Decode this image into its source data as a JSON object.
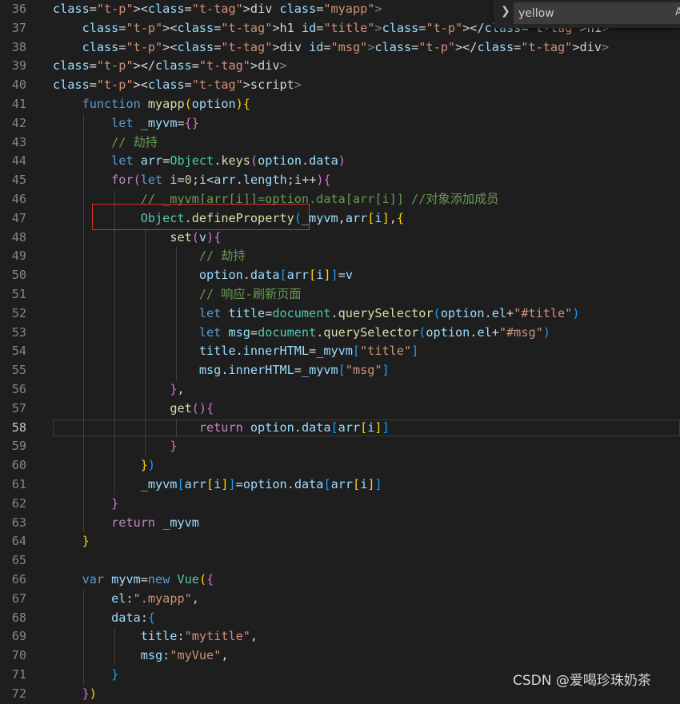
{
  "find_widget": {
    "query": "yellow",
    "toggle_label": "A"
  },
  "watermark": "CSDN @爱喝珍珠奶茶",
  "active_line": "58",
  "highlight_box_target": "Object.defineProperty(",
  "lines": [
    {
      "no": "36",
      "text": "<div class=\"myapp\">"
    },
    {
      "no": "37",
      "text": "    <h1 id=\"title\"></h1>"
    },
    {
      "no": "38",
      "text": "    <div id=\"msg\"></div>"
    },
    {
      "no": "39",
      "text": "</div>"
    },
    {
      "no": "40",
      "text": "<script>"
    },
    {
      "no": "41",
      "text": "    function myapp(option){"
    },
    {
      "no": "42",
      "text": "        let _myvm={}"
    },
    {
      "no": "43",
      "text": "        // 劫持"
    },
    {
      "no": "44",
      "text": "        let arr=Object.keys(option.data)"
    },
    {
      "no": "45",
      "text": "        for(let i=0;i<arr.length;i++){"
    },
    {
      "no": "46",
      "text": "            // _myvm[arr[i]]=option.data[arr[i]] //对象添加成员"
    },
    {
      "no": "47",
      "text": "            Object.defineProperty(_myvm,arr[i],{"
    },
    {
      "no": "48",
      "text": "                set(v){"
    },
    {
      "no": "49",
      "text": "                    // 劫持"
    },
    {
      "no": "50",
      "text": "                    option.data[arr[i]]=v"
    },
    {
      "no": "51",
      "text": "                    // 响应-刷新页面"
    },
    {
      "no": "52",
      "text": "                    let title=document.querySelector(option.el+\"#title\")"
    },
    {
      "no": "53",
      "text": "                    let msg=document.querySelector(option.el+\"#msg\")"
    },
    {
      "no": "54",
      "text": "                    title.innerHTML=_myvm[\"title\"]"
    },
    {
      "no": "55",
      "text": "                    msg.innerHTML=_myvm[\"msg\"]"
    },
    {
      "no": "56",
      "text": "                },"
    },
    {
      "no": "57",
      "text": "                get(){"
    },
    {
      "no": "58",
      "text": "                    return option.data[arr[i]]"
    },
    {
      "no": "59",
      "text": "                }"
    },
    {
      "no": "60",
      "text": "            })"
    },
    {
      "no": "61",
      "text": "            _myvm[arr[i]]=option.data[arr[i]]"
    },
    {
      "no": "62",
      "text": "        }"
    },
    {
      "no": "63",
      "text": "        return _myvm"
    },
    {
      "no": "64",
      "text": "    }"
    },
    {
      "no": "65",
      "text": ""
    },
    {
      "no": "66",
      "text": "    var myvm=new Vue({"
    },
    {
      "no": "67",
      "text": "        el:\".myapp\","
    },
    {
      "no": "68",
      "text": "        data:{"
    },
    {
      "no": "69",
      "text": "            title:\"mytitle\","
    },
    {
      "no": "70",
      "text": "            msg:\"myVue\","
    },
    {
      "no": "71",
      "text": "        }"
    },
    {
      "no": "72",
      "text": "    })"
    }
  ],
  "colors": {
    "background": "#1e1e1e",
    "keyword": "#569cd6",
    "control": "#c586c0",
    "function": "#dcdcaa",
    "variable": "#9cdcfe",
    "string": "#ce9178",
    "comment": "#6a9955",
    "class": "#4ec9b0",
    "number": "#b5cea8",
    "highlight_box": "#d9332a"
  }
}
